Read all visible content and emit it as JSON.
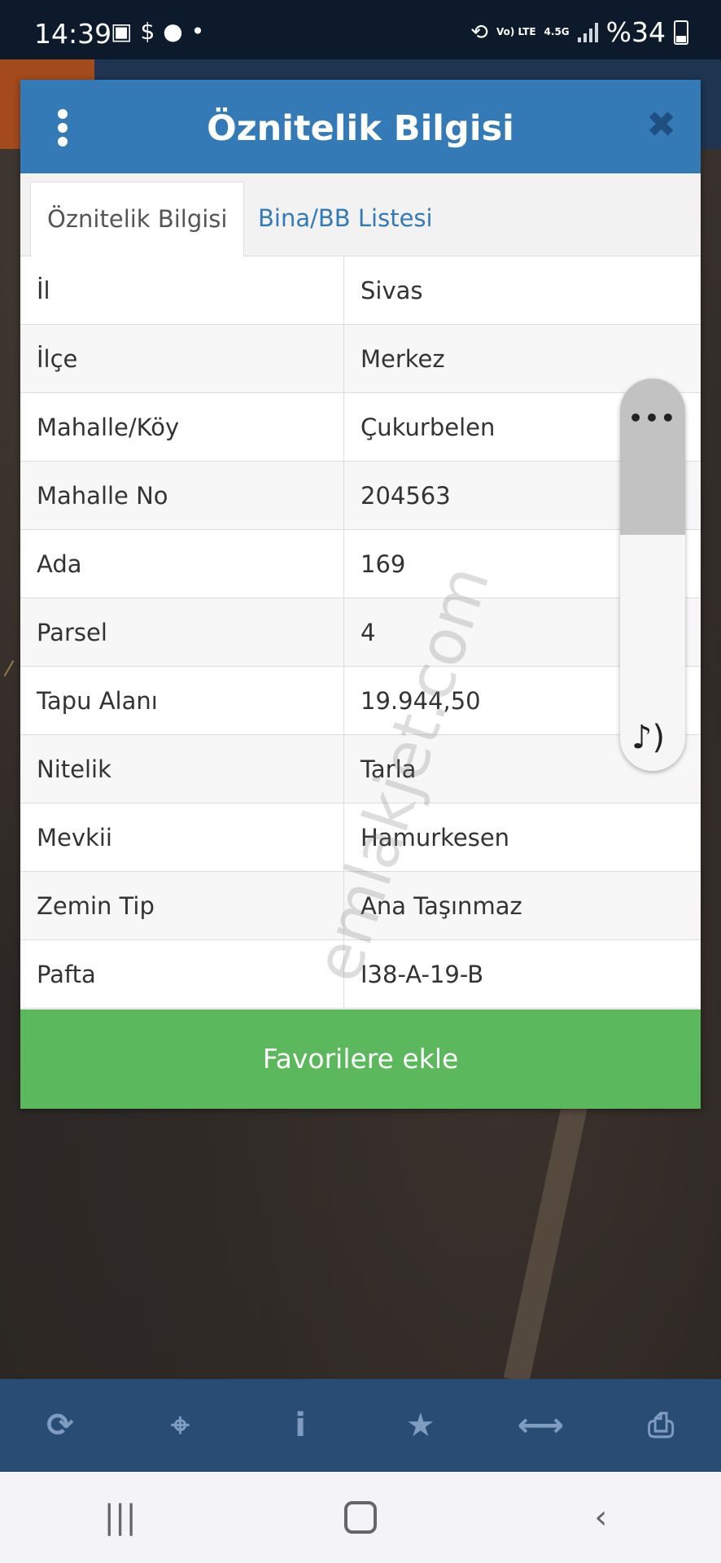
{
  "status_bar": {
    "time": "14:39",
    "battery": "%34",
    "network": "4.5G",
    "volte": "Vo) LTE"
  },
  "dialog": {
    "title": "Öznitelik Bilgisi",
    "tabs": [
      {
        "label": "Öznitelik Bilgisi",
        "active": true
      },
      {
        "label": "Bina/BB Listesi",
        "active": false
      }
    ],
    "rows": [
      {
        "key": "İl",
        "value": "Sivas"
      },
      {
        "key": "İlçe",
        "value": "Merkez"
      },
      {
        "key": "Mahalle/Köy",
        "value": "Çukurbelen"
      },
      {
        "key": "Mahalle No",
        "value": "204563"
      },
      {
        "key": "Ada",
        "value": "169"
      },
      {
        "key": "Parsel",
        "value": "4"
      },
      {
        "key": "Tapu Alanı",
        "value": "19.944,50"
      },
      {
        "key": "Nitelik",
        "value": "Tarla"
      },
      {
        "key": "Mevkii",
        "value": "Hamurkesen"
      },
      {
        "key": "Zemin Tip",
        "value": "Ana Taşınmaz"
      },
      {
        "key": "Pafta",
        "value": "I38-A-19-B"
      }
    ],
    "favorite_button": "Favorilere ekle"
  },
  "watermark": "emlakjet.com",
  "toolbar": {
    "icons": [
      "refresh-icon",
      "crosshair-icon",
      "info-icon",
      "star-icon",
      "measure-icon",
      "print-icon"
    ]
  },
  "colors": {
    "header": "#337ab7",
    "favorite": "#5cb85c",
    "toolbar": "#284c73"
  }
}
